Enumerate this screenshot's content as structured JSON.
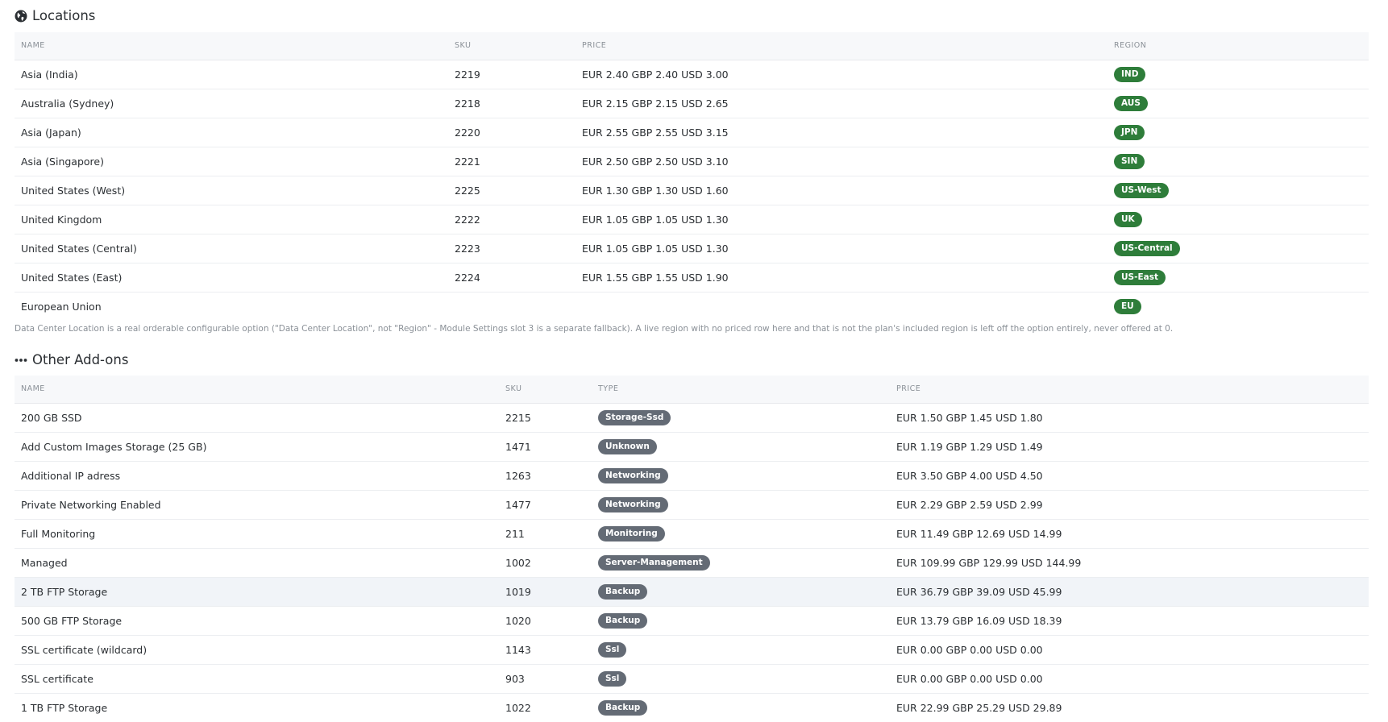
{
  "locations": {
    "title": "Locations",
    "icon": "globe-icon",
    "columns": [
      "NAME",
      "SKU",
      "PRICE",
      "REGION"
    ],
    "rows": [
      {
        "name": "Asia (India)",
        "sku": "2219",
        "price": "EUR 2.40 GBP 2.40 USD 3.00",
        "region": "IND"
      },
      {
        "name": "Australia (Sydney)",
        "sku": "2218",
        "price": "EUR 2.15 GBP 2.15 USD 2.65",
        "region": "AUS"
      },
      {
        "name": "Asia (Japan)",
        "sku": "2220",
        "price": "EUR 2.55 GBP 2.55 USD 3.15",
        "region": "JPN"
      },
      {
        "name": "Asia (Singapore)",
        "sku": "2221",
        "price": "EUR 2.50 GBP 2.50 USD 3.10",
        "region": "SIN"
      },
      {
        "name": "United States (West)",
        "sku": "2225",
        "price": "EUR 1.30 GBP 1.30 USD 1.60",
        "region": "US-West"
      },
      {
        "name": "United Kingdom",
        "sku": "2222",
        "price": "EUR 1.05 GBP 1.05 USD 1.30",
        "region": "UK"
      },
      {
        "name": "United States (Central)",
        "sku": "2223",
        "price": "EUR 1.05 GBP 1.05 USD 1.30",
        "region": "US-Central"
      },
      {
        "name": "United States (East)",
        "sku": "2224",
        "price": "EUR 1.55 GBP 1.55 USD 1.90",
        "region": "US-East"
      },
      {
        "name": "European Union",
        "sku": "",
        "price": "",
        "region": "EU"
      }
    ],
    "note": "Data Center Location is a real orderable configurable option (\"Data Center Location\", not \"Region\" - Module Settings slot 3 is a separate fallback). A live region with no priced row here and that is not the plan's included region is left off the option entirely, never offered at 0."
  },
  "addons": {
    "title": "Other Add-ons",
    "icon": "ellipsis-icon",
    "columns": [
      "NAME",
      "SKU",
      "TYPE",
      "PRICE"
    ],
    "rows": [
      {
        "name": "200 GB SSD",
        "sku": "2215",
        "type": "Storage-Ssd",
        "price": "EUR 1.50 GBP 1.45 USD 1.80"
      },
      {
        "name": "Add Custom Images Storage (25 GB)",
        "sku": "1471",
        "type": "Unknown",
        "price": "EUR 1.19 GBP 1.29 USD 1.49"
      },
      {
        "name": "Additional IP adress",
        "sku": "1263",
        "type": "Networking",
        "price": "EUR 3.50 GBP 4.00 USD 4.50"
      },
      {
        "name": "Private Networking Enabled",
        "sku": "1477",
        "type": "Networking",
        "price": "EUR 2.29 GBP 2.59 USD 2.99"
      },
      {
        "name": "Full Monitoring",
        "sku": "211",
        "type": "Monitoring",
        "price": "EUR 11.49 GBP 12.69 USD 14.99"
      },
      {
        "name": "Managed",
        "sku": "1002",
        "type": "Server-Management",
        "price": "EUR 109.99 GBP 129.99 USD 144.99"
      },
      {
        "name": "2 TB FTP Storage",
        "sku": "1019",
        "type": "Backup",
        "price": "EUR 36.79 GBP 39.09 USD 45.99",
        "highlighted": true
      },
      {
        "name": "500 GB FTP Storage",
        "sku": "1020",
        "type": "Backup",
        "price": "EUR 13.79 GBP 16.09 USD 18.39"
      },
      {
        "name": "SSL certificate (wildcard)",
        "sku": "1143",
        "type": "Ssl",
        "price": "EUR 0.00 GBP 0.00 USD 0.00"
      },
      {
        "name": "SSL certificate",
        "sku": "903",
        "type": "Ssl",
        "price": "EUR 0.00 GBP 0.00 USD 0.00"
      },
      {
        "name": "1 TB FTP Storage",
        "sku": "1022",
        "type": "Backup",
        "price": "EUR 22.99 GBP 25.29 USD 29.89"
      }
    ]
  },
  "colors": {
    "region_badge": "#2e7d3a",
    "type_badge": "#646b75",
    "header_bg": "#f7f8fa",
    "highlight_row": "#f1f4f8"
  }
}
